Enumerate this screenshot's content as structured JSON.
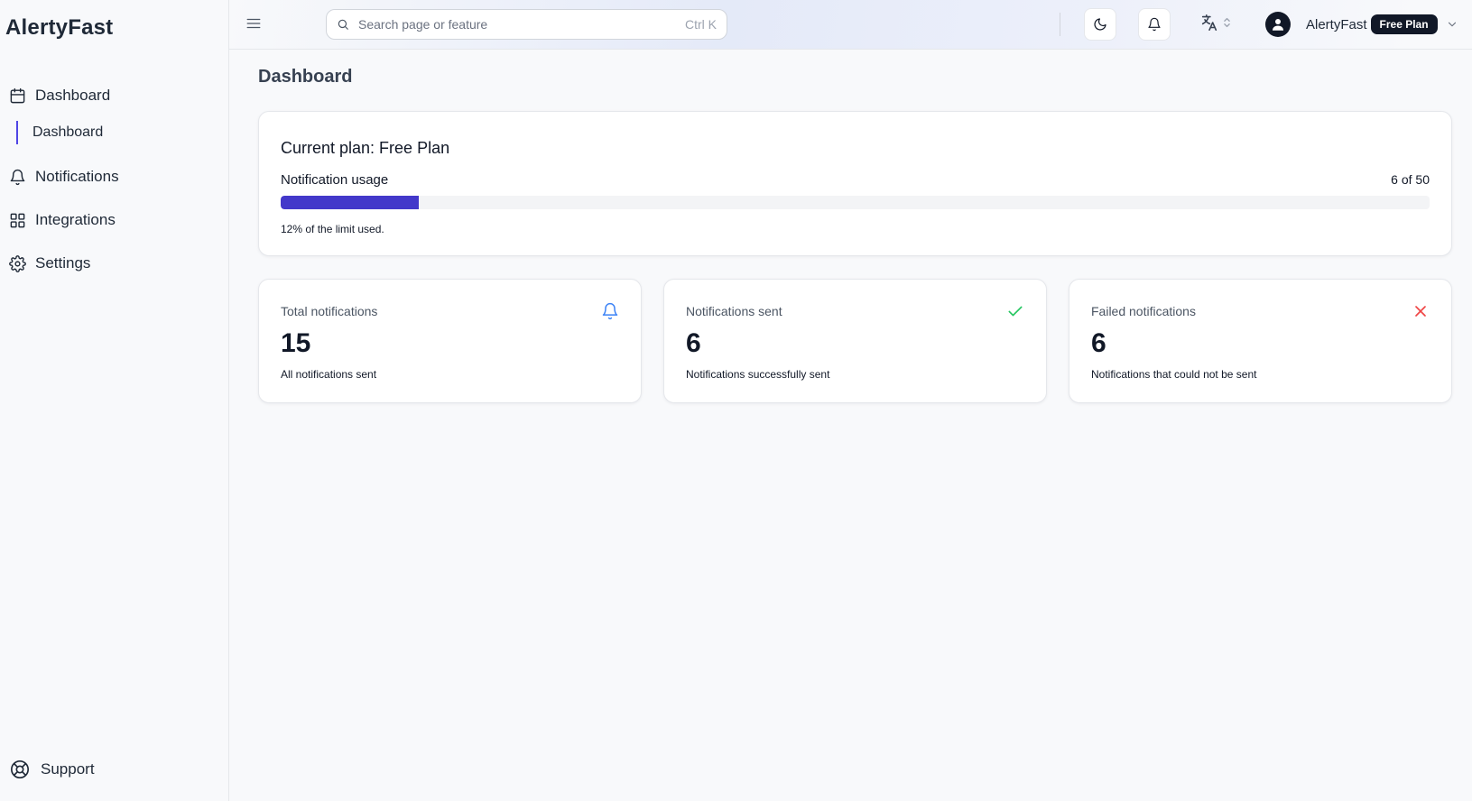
{
  "app": {
    "brand": "AlertyFast"
  },
  "sidebar": {
    "items": [
      {
        "label": "Dashboard",
        "icon": "calendar-icon"
      },
      {
        "label": "Notifications",
        "icon": "bell-icon"
      },
      {
        "label": "Integrations",
        "icon": "grid-icon"
      },
      {
        "label": "Settings",
        "icon": "gear-icon"
      }
    ],
    "sub_item": {
      "label": "Dashboard"
    },
    "support": {
      "label": "Support",
      "icon": "lifebuoy-icon"
    }
  },
  "header": {
    "search": {
      "placeholder": "Search page or feature",
      "shortcut": "Ctrl K"
    },
    "user": {
      "name": "AlertyFast",
      "plan_badge": "Free Plan"
    }
  },
  "page": {
    "title": "Dashboard"
  },
  "plan_card": {
    "title": "Current plan: Free Plan",
    "usage_label": "Notification usage",
    "usage_count": "6 of 50",
    "usage_percent": 12,
    "usage_note": "12% of the limit used."
  },
  "stats": [
    {
      "label": "Total notifications",
      "value": "15",
      "description": "All notifications sent",
      "icon": "bell-icon",
      "color": "#3b82f6"
    },
    {
      "label": "Notifications sent",
      "value": "6",
      "description": "Notifications successfully sent",
      "icon": "check-icon",
      "color": "#22c55e"
    },
    {
      "label": "Failed notifications",
      "value": "6",
      "description": "Notifications that could not be sent",
      "icon": "x-icon",
      "color": "#ef4444"
    }
  ],
  "colors": {
    "accent": "#4338ca",
    "sidebar_active": "#4f46e5"
  }
}
